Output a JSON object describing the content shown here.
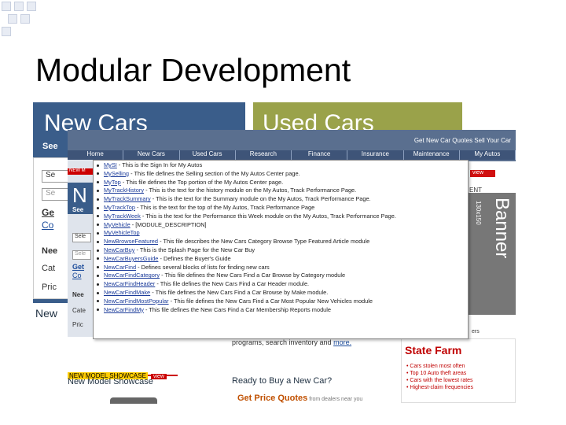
{
  "slide": {
    "title": "Modular Development"
  },
  "panels": {
    "new_cars": "New Cars",
    "used_cars": "Used Cars",
    "new_prefix": "New"
  },
  "back_panel": {
    "see_label": "See",
    "sel_label": "Se",
    "get_link": "Ge",
    "co_link": "Co",
    "nee_label": "Nee",
    "cat_label": "Cat",
    "pri_label": "Pric"
  },
  "site": {
    "quote_links": "Get New Car Quotes   Sell Your Car",
    "nav": [
      "Home",
      "New Cars",
      "Used Cars",
      "Research",
      "Finance",
      "Insurance",
      "Maintenance",
      "My Autos"
    ]
  },
  "front_left": {
    "red_tag": "NEW M",
    "n_letter": "N",
    "see": "See",
    "sele1": "Sele",
    "sele2": "Sele",
    "get": "Get",
    "co": "Co",
    "nee": "Nee",
    "cate": "Cate",
    "pric": "Pric"
  },
  "modules": [
    {
      "name": "MySI",
      "desc": " - This is the Sign In for My Autos"
    },
    {
      "name": "MySelling",
      "desc": " - This file defines the Selling section of the My Autos Center page."
    },
    {
      "name": "MyTop",
      "desc": " - This file defines the Top portion of the My Autos Center page."
    },
    {
      "name": "MyTrackHistory",
      "desc": " - This is the text for the history module on the My Autos, Track Performance Page."
    },
    {
      "name": "MyTrackSummary",
      "desc": " - This is the text for the Summary module on the My Autos, Track Performance Page."
    },
    {
      "name": "MyTrackTop",
      "desc": " - This is the text for the top of the My Autos, Track Performance Page"
    },
    {
      "name": "MyTrackWeek",
      "desc": " - This is the text for the Performance this Week module on the My Autos, Track Performance Page."
    },
    {
      "name": "MyVehicle",
      "desc": " - [MODULE_DESCRIPTION]"
    },
    {
      "name": "MyVehicleTop",
      "desc": ""
    },
    {
      "name": "NewBrowseFeatured",
      "desc": " - This file describes the New Cars Category Browse Type Featured Article module"
    },
    {
      "name": "NewCarBuy",
      "desc": " - This is the Splash Page for the New Car Buy"
    },
    {
      "name": "NewCarBuyersGuide",
      "desc": " - Defines the Buyer's Guide"
    },
    {
      "name": "NewCarFind",
      "desc": " - Defines several blocks of lists for finding new cars"
    },
    {
      "name": "NewCarFindCategory",
      "desc": " - This file defines the New Cars Find a Car Browse by Category module"
    },
    {
      "name": "NewCarFindHeader",
      "desc": " - This file defines the New Cars Find a Car Header module."
    },
    {
      "name": "NewCarFindMake",
      "desc": " - This file defines the New Cars Find a Car Browse by Make module."
    },
    {
      "name": "NewCarFindMostPopular",
      "desc": " - This file defines the New Cars Find a Car Most Popular New Vehicles module"
    },
    {
      "name": "NewCarFindMy",
      "desc": " - This file defines the New Cars Find a Car Membership Reports module"
    }
  ],
  "right": {
    "red_strip": "view",
    "ent": "ENT",
    "banner": "Banner",
    "banner_size": "130x150",
    "sf_top": "ers",
    "sf_logo": "State Farm",
    "sf_items": [
      "Cars stolen most often",
      "Top 10 Auto theft areas",
      "Cars with the lowest rates",
      "Highest-claim frequencies"
    ],
    "programs_text": "programs, search inventory  and ",
    "programs_more": "more."
  },
  "bottom": {
    "showcase_tag": "NEW MODEL SHOWCASE",
    "showcase_view": "view",
    "showcase_title": "New Model Showcase",
    "ready_title": "Ready to Buy a New Car?",
    "price_quotes": "Get Price Quotes",
    "price_sub": " from dealers near you"
  }
}
